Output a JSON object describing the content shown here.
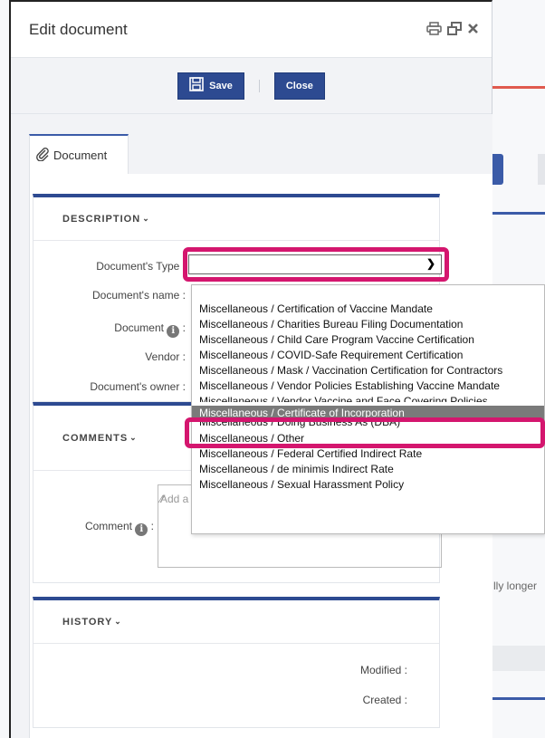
{
  "modal": {
    "title": "Edit document",
    "icons": [
      "print-icon",
      "restore-window-icon",
      "close-icon"
    ]
  },
  "toolbar": {
    "save_label": "Save",
    "close_label": "Close"
  },
  "tab": {
    "label": "Document"
  },
  "description": {
    "title": "DESCRIPTION",
    "type_label": "Document's Type :",
    "name_label": "Document's name :",
    "document_label": "Document",
    "vendor_label": "Vendor :",
    "owner_label": "Document's owner :"
  },
  "dropdown": {
    "options": [
      "Miscellaneous / Certification of Vaccine Mandate",
      "Miscellaneous / Charities Bureau Filing Documentation",
      "Miscellaneous / Child Care Program Vaccine Certification",
      "Miscellaneous / COVID-Safe Requirement Certification",
      "Miscellaneous / Mask / Vaccination Certification for Contractors",
      "Miscellaneous / Vendor Policies Establishing Vaccine Mandate",
      "Miscellaneous / Vendor Vaccine and Face Covering Policies",
      "Miscellaneous / Certificate of Incorporation",
      "Miscellaneous / Doing Business As (DBA)",
      "Miscellaneous / Other",
      "Miscellaneous / Federal Certified Indirect Rate",
      "Miscellaneous / de minimis Indirect Rate",
      "Miscellaneous / Sexual Harassment Policy"
    ],
    "selected": "Miscellaneous / Certificate of Incorporation"
  },
  "comments": {
    "title": "COMMENTS",
    "comment_label": "Comment",
    "placeholder": "Add a"
  },
  "history": {
    "title": "HISTORY",
    "modified_label": "Modified :",
    "created_label": "Created :"
  },
  "background": {
    "text_fragment": "lly longer"
  },
  "colors": {
    "primary": "#2d4a91",
    "highlight": "#d4166e",
    "selected_option": "#7a7a7a"
  }
}
